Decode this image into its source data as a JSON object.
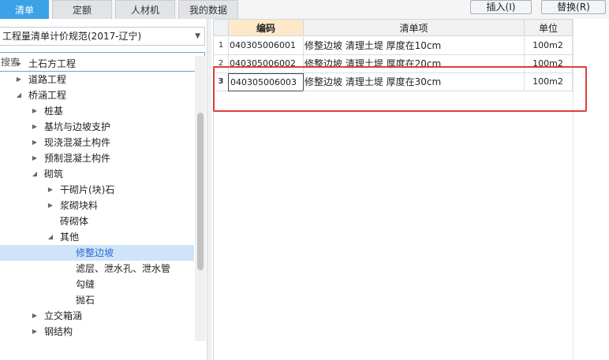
{
  "tabs": [
    {
      "label": "清单",
      "active": true
    },
    {
      "label": "定额",
      "active": false
    },
    {
      "label": "人材机",
      "active": false
    },
    {
      "label": "我的数据",
      "active": false
    }
  ],
  "toolbar": {
    "insert_label": "插入(I)",
    "replace_label": "替换(R)"
  },
  "left": {
    "spec_select": "工程量清单计价规范(2017-辽宁)",
    "search_placeholder": "搜索",
    "tree": [
      {
        "label": "土石方工程",
        "toggle": "collapsed",
        "level": 1
      },
      {
        "label": "道路工程",
        "toggle": "collapsed",
        "level": 1
      },
      {
        "label": "桥涵工程",
        "toggle": "expanded",
        "level": 1
      },
      {
        "label": "桩基",
        "toggle": "collapsed",
        "level": 2
      },
      {
        "label": "基坑与边坡支护",
        "toggle": "collapsed",
        "level": 2
      },
      {
        "label": "现浇混凝土构件",
        "toggle": "collapsed",
        "level": 2
      },
      {
        "label": "预制混凝土构件",
        "toggle": "collapsed",
        "level": 2
      },
      {
        "label": "砌筑",
        "toggle": "expanded",
        "level": 2
      },
      {
        "label": "干砌片(块)石",
        "toggle": "collapsed",
        "level": 3
      },
      {
        "label": "浆砌块料",
        "toggle": "collapsed",
        "level": 3
      },
      {
        "label": "砖砌体",
        "toggle": "none",
        "level": 3
      },
      {
        "label": "其他",
        "toggle": "expanded",
        "level": 3
      },
      {
        "label": "修整边坡",
        "toggle": "none",
        "level": 4,
        "selected": true
      },
      {
        "label": "滤层、泄水孔、泄水管",
        "toggle": "none",
        "level": 4
      },
      {
        "label": "勾缝",
        "toggle": "none",
        "level": 4
      },
      {
        "label": "抛石",
        "toggle": "none",
        "level": 4
      },
      {
        "label": "立交箱涵",
        "toggle": "collapsed",
        "level": 2
      },
      {
        "label": "钢结构",
        "toggle": "collapsed",
        "level": 2
      }
    ]
  },
  "grid": {
    "headers": {
      "code": "编码",
      "item": "清单项",
      "unit": "单位"
    },
    "rows": [
      {
        "index": "1",
        "code": "040305006001",
        "item": "修整边坡 清理土堤 厚度在10cm",
        "unit": "100m2"
      },
      {
        "index": "2",
        "code": "040305006002",
        "item": "修整边坡 清理土堤 厚度在20cm",
        "unit": "100m2"
      },
      {
        "index": "3",
        "code": "040305006003",
        "item": "修整边坡 清理土堤 厚度在30cm",
        "unit": "100m2",
        "current": true
      }
    ]
  },
  "colors": {
    "accent": "#3ca2e8",
    "selection": "#cfe4f8",
    "highlight_box": "#e03c3c"
  },
  "icons": {
    "toggle_collapsed": "triangle-right-icon",
    "toggle_expanded": "triangle-down-icon",
    "dropdown": "chevron-down-icon"
  }
}
